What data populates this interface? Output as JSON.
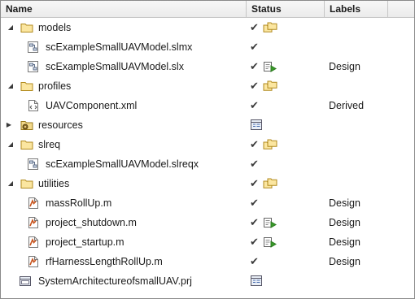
{
  "columns": {
    "name": "Name",
    "status": "Status",
    "labels": "Labels"
  },
  "rows": [
    {
      "name": "models",
      "label": "",
      "check": "✔"
    },
    {
      "name": "scExampleSmallUAVModel.slmx",
      "label": "",
      "check": "✔"
    },
    {
      "name": "scExampleSmallUAVModel.slx",
      "label": "Design",
      "check": "✔"
    },
    {
      "name": "profiles",
      "label": "",
      "check": "✔"
    },
    {
      "name": "UAVComponent.xml",
      "label": "Derived",
      "check": "✔"
    },
    {
      "name": "resources",
      "label": "",
      "check": ""
    },
    {
      "name": "slreq",
      "label": "",
      "check": "✔"
    },
    {
      "name": "scExampleSmallUAVModel.slreqx",
      "label": "",
      "check": "✔"
    },
    {
      "name": "utilities",
      "label": "",
      "check": "✔"
    },
    {
      "name": "massRollUp.m",
      "label": "Design",
      "check": "✔"
    },
    {
      "name": "project_shutdown.m",
      "label": "Design",
      "check": "✔"
    },
    {
      "name": "project_startup.m",
      "label": "Design",
      "check": "✔"
    },
    {
      "name": "rfHarnessLengthRollUp.m",
      "label": "Design",
      "check": "✔"
    },
    {
      "name": "SystemArchitectureofsmallUAV.prj",
      "label": "",
      "check": ""
    }
  ],
  "glyphs": {
    "expanded": "◢",
    "collapsed": "▶"
  },
  "icons": {
    "folder": "folder-icon",
    "folder_resources": "resources-folder-icon",
    "slmx": "simulink-model-file-icon",
    "slx": "simulink-model-file-icon",
    "xml": "xml-file-icon",
    "slreqx": "requirements-file-icon",
    "m": "matlab-script-icon",
    "prj": "project-file-icon"
  },
  "colors": {
    "folder": "#e8c24a",
    "check": "#3c3c3c",
    "green_play": "#3a9a2a"
  }
}
